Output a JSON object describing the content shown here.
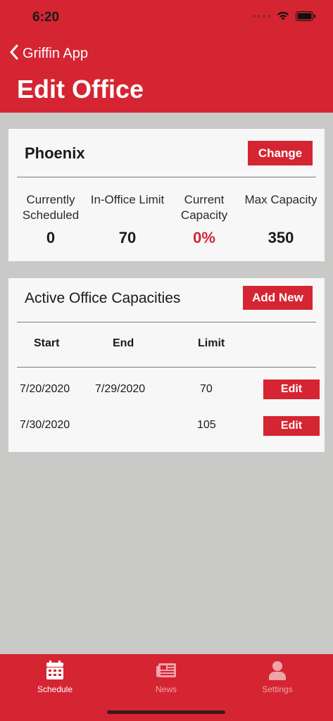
{
  "status": {
    "time": "6:20"
  },
  "nav": {
    "back_label": "Griffin App",
    "title": "Edit Office"
  },
  "office": {
    "name": "Phoenix",
    "change_label": "Change",
    "stats": [
      {
        "label": "Currently Scheduled",
        "value": "0",
        "highlight": false
      },
      {
        "label": "In-Office Limit",
        "value": "70",
        "highlight": false
      },
      {
        "label": "Current Capacity",
        "value": "0%",
        "highlight": true
      },
      {
        "label": "Max Capacity",
        "value": "350",
        "highlight": false
      }
    ]
  },
  "capacities": {
    "title": "Active Office Capacities",
    "add_label": "Add New",
    "headers": {
      "start": "Start",
      "end": "End",
      "limit": "Limit"
    },
    "rows": [
      {
        "start": "7/20/2020",
        "end": "7/29/2020",
        "limit": "70",
        "edit_label": "Edit"
      },
      {
        "start": "7/30/2020",
        "end": "",
        "limit": "105",
        "edit_label": "Edit"
      }
    ]
  },
  "tabs": [
    {
      "label": "Schedule",
      "icon": "calendar-icon",
      "active": true
    },
    {
      "label": "News",
      "icon": "newspaper-icon",
      "active": false
    },
    {
      "label": "Settings",
      "icon": "person-icon",
      "active": false
    }
  ],
  "colors": {
    "accent": "#d52532",
    "background": "#c9c9c7",
    "card": "#f7f7f7"
  }
}
